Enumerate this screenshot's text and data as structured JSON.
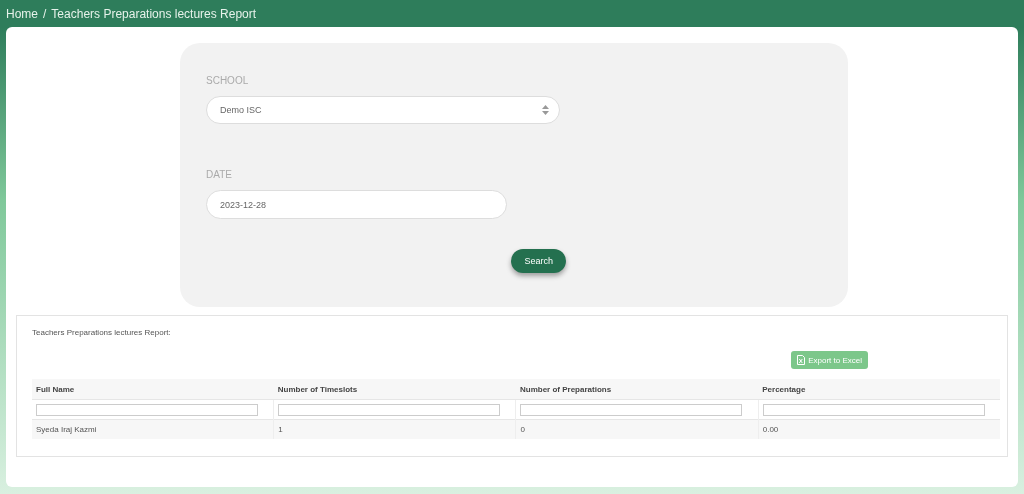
{
  "breadcrumb": {
    "items": [
      "Home",
      "Teachers Preparations lectures Report"
    ],
    "separator": "/"
  },
  "filters": {
    "school": {
      "label": "SCHOOL",
      "value": "Demo ISC"
    },
    "date": {
      "label": "DATE",
      "value": "2023-12-28"
    },
    "search_button": "Search"
  },
  "report": {
    "title": "Teachers Preparations lectures Report:",
    "export_button": "Export to Excel",
    "table": {
      "columns": [
        "Full Name",
        "Number of Timeslots",
        "Number of Preparations",
        "Percentage"
      ],
      "rows": [
        [
          "Syeda Iraj Kazmi",
          "1",
          "0",
          "0.00"
        ]
      ]
    }
  }
}
